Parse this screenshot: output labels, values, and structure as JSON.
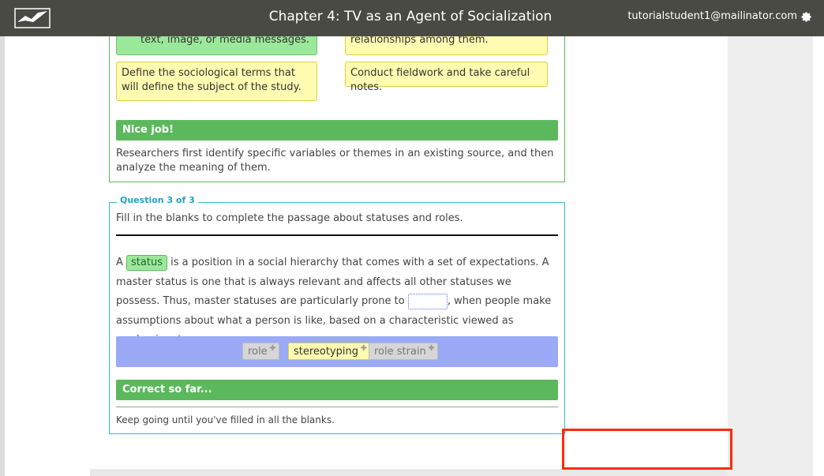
{
  "header": {
    "title": "Chapter 4: TV as an Agent of Socialization",
    "user_email": "tutorialstudent1@mailinator.com",
    "logo_icon": "bird-logo-icon",
    "settings_icon": "gear-icon"
  },
  "question2": {
    "cards": [
      {
        "text": "Look for recurring themes in a text, image, or media messages.",
        "state": "correct"
      },
      {
        "text": "Analyze any patterns and relationships among them.",
        "state": "placed"
      },
      {
        "text": "Define the sociological terms that will define the subject of the study.",
        "state": "placed"
      },
      {
        "text": "Conduct fieldwork and take careful notes.",
        "state": "placed"
      }
    ],
    "banner": "Nice job!",
    "feedback": "Researchers first identify specific variables or themes in an existing source, and then analyze the meaning of them."
  },
  "question3": {
    "legend": "Question 3 of 3",
    "prompt": "Fill in the blanks to complete the passage about statuses and roles.",
    "passage_part1": "A ",
    "blank1": "status",
    "passage_part2": " is a position in a social hierarchy that comes with a set of expectations. A master status is one that is always relevant and affects all other statuses we possess. Thus, master statuses are particularly prone to ",
    "passage_part3": ", when people make assumptions about what a person is like, based on a characteristic viewed as predominant.",
    "word_bank": [
      {
        "label": "role",
        "state": "available"
      },
      {
        "label": "stereotyping",
        "state": "selected"
      },
      {
        "label": "role strain",
        "state": "available"
      }
    ],
    "banner": "Correct so far...",
    "feedback": "Keep going until you've filled in all the blanks."
  },
  "colors": {
    "header_bg": "#4a4a44",
    "correct_green": "#5cb85c",
    "question_border": "#38b7c9",
    "word_bank_bg": "#9aaaf7",
    "highlight_red": "#ff2a0a"
  }
}
